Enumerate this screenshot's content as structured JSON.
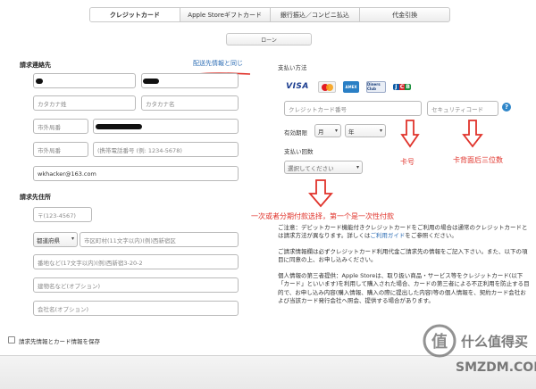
{
  "tabs": [
    {
      "label": "クレジットカード",
      "active": true
    },
    {
      "label": "Apple Storeギフトカード",
      "active": false
    },
    {
      "label": "銀行振込／コンビニ払込",
      "active": false
    },
    {
      "label": "代金引換",
      "active": false
    }
  ],
  "loan_button": "ローン",
  "billing_contact": {
    "title": "請求連絡先",
    "copy_link": "配送先情報と同じ",
    "placeholders": {
      "kana_last": "カタカナ姓",
      "kana_first": "カタカナ名",
      "area_code": "市外局番",
      "area_code2": "市外局番",
      "phone": "(携帯電話番号 (例: 1234-5678)"
    },
    "email_value": "wkhacker@163.com"
  },
  "billing_address": {
    "title": "請求先住所",
    "postal_placeholder": "〒(123-4567)",
    "prefecture_label": "都道府県",
    "city_placeholder": "市区町村(11文字以内)(例)西新宿区",
    "street_placeholder": "番地など(17文字以内)(例)西新宿3-20-2",
    "building_placeholder": "建物名など(オプション)",
    "company_placeholder": "会社名(オプション)"
  },
  "payment": {
    "title": "支払い方法",
    "card_logos": [
      {
        "name": "visa",
        "text": "VISA"
      },
      {
        "name": "mastercard",
        "text": ""
      },
      {
        "name": "amex",
        "text": "AMEX"
      },
      {
        "name": "diners",
        "text": "Diners Club"
      },
      {
        "name": "jcb",
        "text": "JCB"
      }
    ],
    "card_number_placeholder": "クレジットカード番号",
    "security_code_placeholder": "セキュリティコード",
    "help_icon_glyph": "?",
    "expiry_label": "有効期限",
    "month_label": "月",
    "year_label": "年",
    "installment_label": "支払い回数",
    "installment_placeholder": "選択してください",
    "dropdown_glyph": "▾"
  },
  "notes": [
    "ご注意：デビットカード機能付きクレジットカードをご利用の場合は通常のクレジットカードとは請求方法が異なります。詳しくは",
    "ご利用ガイド",
    "をご参照ください。",
    "ご請求情報欄は必ずクレジットカード利用代金ご請求先の情報をご記入下さい。また、以下の項目に同意の上、お申し込みください。",
    "個人情報の第三者提供：Apple Storeは、取り扱い商品・サービス等をクレジットカード(以下「カード」といいます)を利用して購入された場合、カードの第三者による不正利用を防止する目的で、お申し込み内容(購入情報、購入の際に提出した内容)等の個人情報を、契約カード会社および当該カード発行会社へ照会、提供する場合があります。"
  ],
  "annotations": {
    "card_number": "卡号",
    "security_code": "卡背面后三位数",
    "installments": "一次或者分期付款选择，第一个是一次性付款"
  },
  "save_checkbox_label": "請求先情報とカード情報を保存",
  "watermark": {
    "line1": "什么值得买",
    "line2": "SMZDM.COM",
    "glyph": "值"
  },
  "colors": {
    "accent": "#2e6eb5",
    "annotation": "#e0332b"
  }
}
